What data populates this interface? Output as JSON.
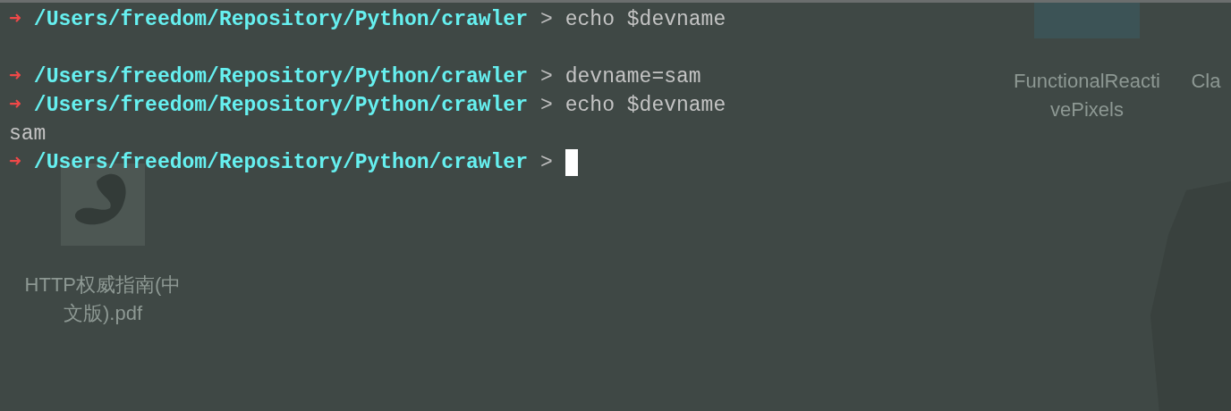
{
  "desktop": {
    "icons": [
      {
        "kind": "document",
        "label_lines": [
          "HTTP权威指南(中",
          "文版).pdf"
        ]
      },
      {
        "kind": "folder",
        "label_lines": [
          "FunctionalReacti",
          "vePixels"
        ]
      },
      {
        "kind": "partial",
        "label_lines": [
          "Cla"
        ]
      }
    ]
  },
  "terminal": {
    "lines": [
      {
        "kind": "prompt",
        "arrow": "➜",
        "path": "/Users/freedom/Repository/Python/crawler",
        "separator": ">",
        "command": "echo $devname",
        "cursor": false
      },
      {
        "kind": "blank"
      },
      {
        "kind": "prompt",
        "arrow": "➜",
        "path": "/Users/freedom/Repository/Python/crawler",
        "separator": ">",
        "command": "devname=sam",
        "cursor": false
      },
      {
        "kind": "prompt",
        "arrow": "➜",
        "path": "/Users/freedom/Repository/Python/crawler",
        "separator": ">",
        "command": "echo $devname",
        "cursor": false
      },
      {
        "kind": "output",
        "text": "sam"
      },
      {
        "kind": "prompt",
        "arrow": "➜",
        "path": "/Users/freedom/Repository/Python/crawler",
        "separator": ">",
        "cursor": true
      }
    ]
  }
}
